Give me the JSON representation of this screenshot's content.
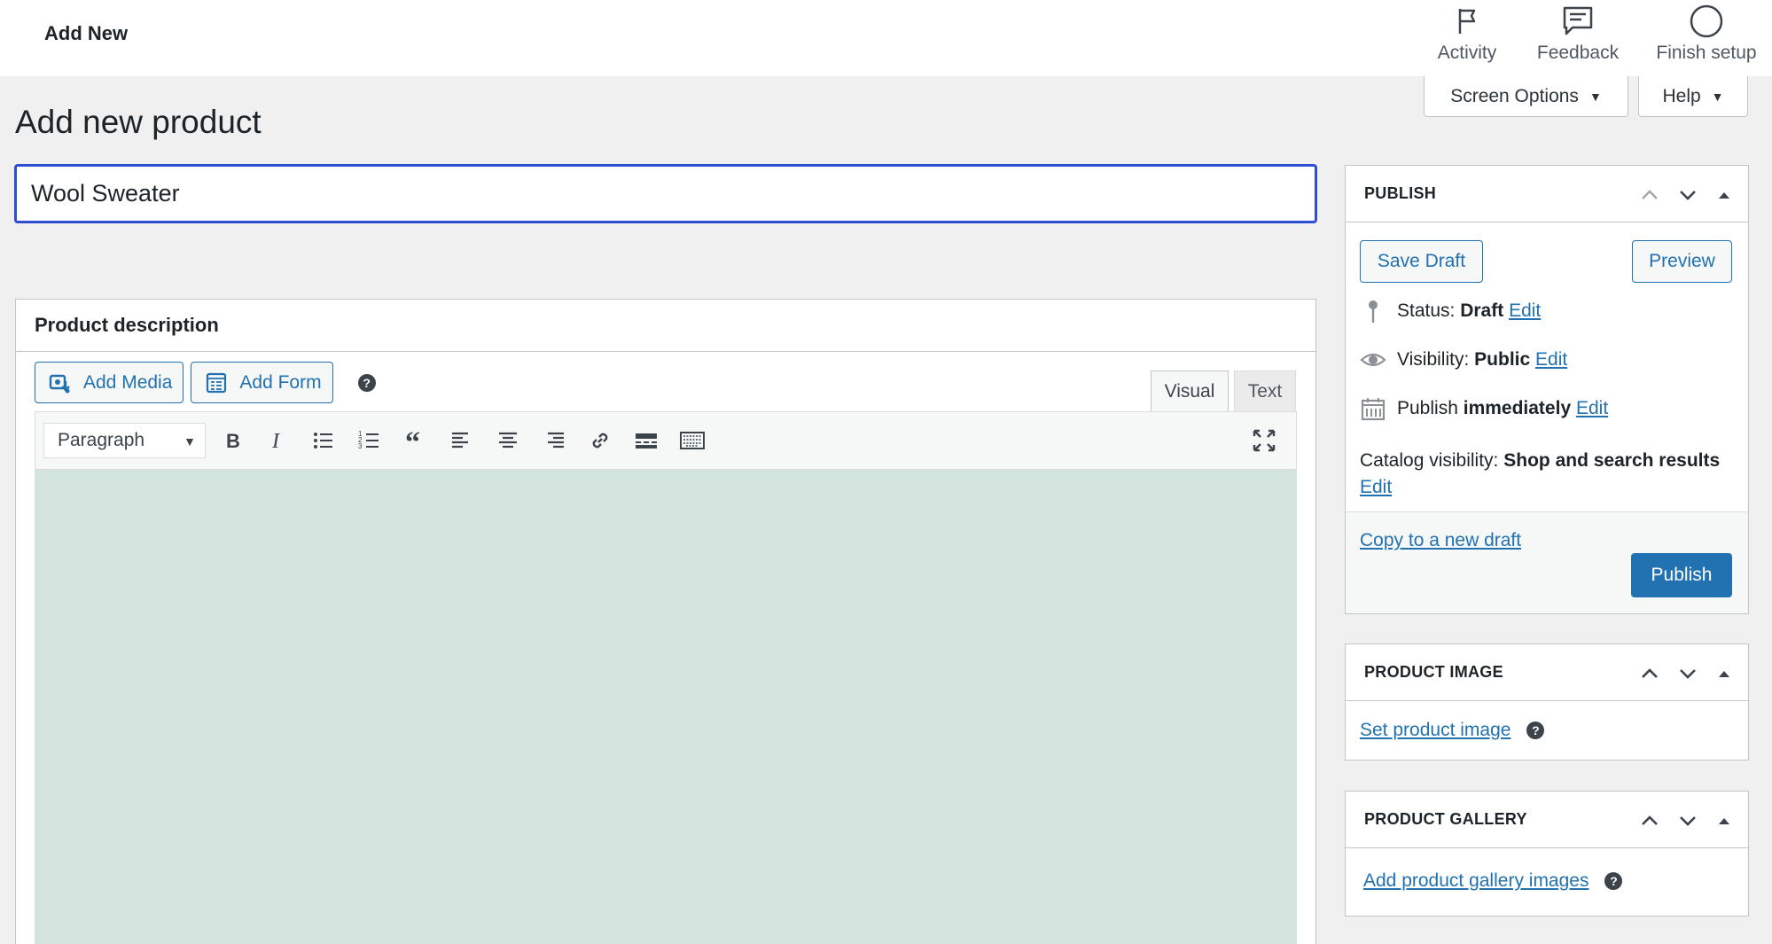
{
  "topbar": {
    "breadcrumb": "Add New",
    "activity_label": "Activity",
    "feedback_label": "Feedback",
    "finish_label": "Finish setup"
  },
  "screen_meta": {
    "screen_options_label": "Screen Options",
    "help_label": "Help"
  },
  "page": {
    "title": "Add new product",
    "product_title_value": "Wool Sweater"
  },
  "description": {
    "heading": "Product description",
    "add_media_label": "Add Media",
    "add_form_label": "Add Form",
    "help_glyph": "?",
    "tab_visual": "Visual",
    "tab_text": "Text",
    "format_value": "Paragraph",
    "editor_bg": "#d3e4de"
  },
  "publish": {
    "heading": "PUBLISH",
    "save_draft_label": "Save Draft",
    "preview_label": "Preview",
    "status_label": "Status:",
    "status_value": "Draft",
    "visibility_label": "Visibility:",
    "visibility_value": "Public",
    "publish_label": "Publish",
    "publish_value": "immediately",
    "edit_label": "Edit",
    "catalog_label": "Catalog visibility:",
    "catalog_value": "Shop and search results",
    "copy_draft_label": "Copy to a new draft",
    "publish_button_label": "Publish"
  },
  "product_image": {
    "heading": "PRODUCT IMAGE",
    "link_label": "Set product image"
  },
  "product_gallery": {
    "heading": "PRODUCT GALLERY",
    "link_label": "Add product gallery images"
  },
  "colors": {
    "accent": "#2271b1",
    "focus_border": "#2c4fd3",
    "background": "#f0f0f1"
  }
}
